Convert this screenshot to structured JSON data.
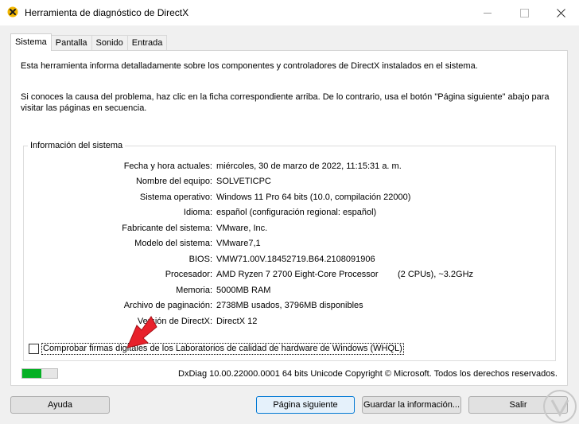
{
  "window": {
    "title": "Herramienta de diagnóstico de DirectX",
    "controls": {
      "minimize": "—",
      "maximize": "☐",
      "close": "✕"
    }
  },
  "tabs": [
    {
      "label": "Sistema",
      "active": true
    },
    {
      "label": "Pantalla",
      "active": false
    },
    {
      "label": "Sonido",
      "active": false
    },
    {
      "label": "Entrada",
      "active": false
    }
  ],
  "intro": {
    "line1": "Esta herramienta informa detalladamente sobre los componentes y controladores de DirectX instalados en el sistema.",
    "line2": "Si conoces la causa del problema, haz clic en la ficha correspondiente arriba. De lo contrario, usa el botón \"Página siguiente\" abajo para visitar las páginas en secuencia."
  },
  "system_info": {
    "group_title": "Información del sistema",
    "rows": [
      {
        "label": "Fecha y hora actuales:",
        "value": "miércoles, 30 de marzo de 2022, 11:15:31 a. m."
      },
      {
        "label": "Nombre del equipo:",
        "value": "SOLVETICPC"
      },
      {
        "label": "Sistema operativo:",
        "value": "Windows 11 Pro 64 bits (10.0, compilación 22000)"
      },
      {
        "label": "Idioma:",
        "value": "español (configuración regional: español)"
      },
      {
        "label": "Fabricante del sistema:",
        "value": "VMware, Inc."
      },
      {
        "label": "Modelo del sistema:",
        "value": "VMware7,1"
      },
      {
        "label": "BIOS:",
        "value": "VMW71.00V.18452719.B64.2108091906"
      },
      {
        "label": "Procesador:",
        "value": "AMD Ryzen 7 2700 Eight-Core Processor"
      },
      {
        "label": "Memoria:",
        "value": "5000MB RAM"
      },
      {
        "label": "Archivo de paginación:",
        "value": "2738MB usados, 3796MB disponibles"
      },
      {
        "label": "Versión de DirectX:",
        "value": "DirectX 12"
      }
    ],
    "processor_extra": "(2 CPUs), ~3.2GHz"
  },
  "whql_checkbox": {
    "label": "Comprobar firmas digitales de los Laboratorios de calidad de hardware de Windows (WHQL)",
    "checked": false
  },
  "progress": {
    "fraction": 0.55,
    "color": "#06b025"
  },
  "footer_text": "DxDiag 10.00.22000.0001 64 bits Unicode  Copyright © Microsoft. Todos los derechos reservados.",
  "buttons": {
    "help": "Ayuda",
    "next": "Página siguiente",
    "save": "Guardar la información...",
    "exit": "Salir"
  },
  "colors": {
    "accent": "#0078d4",
    "annotation_arrow": "#e8212b",
    "progress_green": "#06b025"
  }
}
